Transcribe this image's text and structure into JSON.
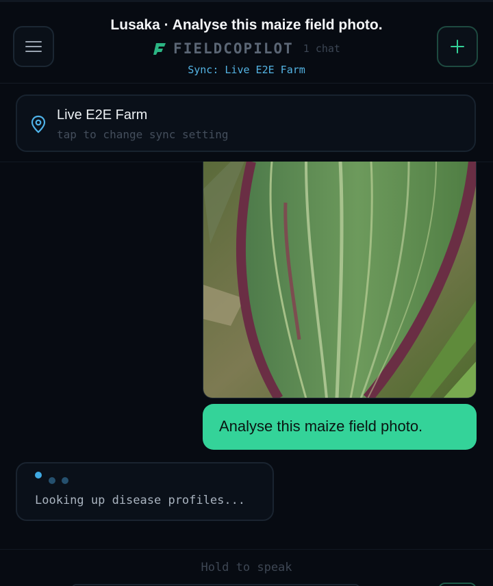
{
  "header": {
    "title": "Lusaka · Analyse this maize field photo.",
    "brand": "FIELDCOPILOT",
    "chat_count": "1 chat",
    "sync": "Sync: Live E2E Farm",
    "menu_icon": "hamburger-menu-icon",
    "new_icon": "plus-icon",
    "brand_icon": "fieldcopilot-logo-icon"
  },
  "farm": {
    "name": "Live E2E Farm",
    "hint": "tap to change sync setting",
    "icon": "location-pin-icon"
  },
  "messages": [
    {
      "role": "user",
      "image": "maize leaf with purple-edged streaks",
      "text": "Analyse this maize field photo."
    },
    {
      "role": "assistant",
      "status": "Looking up disease profiles..."
    }
  ],
  "footer": {
    "hold_label": "Hold to speak"
  },
  "colors": {
    "accent": "#34d399",
    "sync": "#54b4e4",
    "background": "#070b12"
  }
}
